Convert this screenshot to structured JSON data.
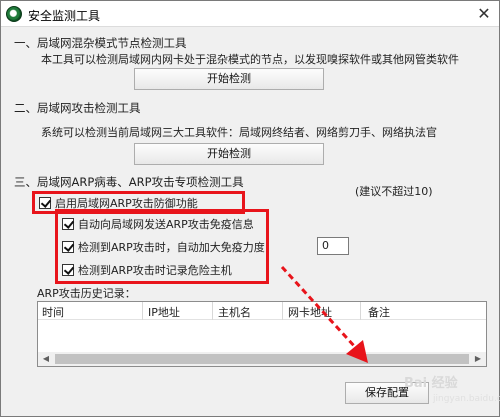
{
  "window": {
    "title": "安全监测工具",
    "close_glyph": "✕"
  },
  "section1": {
    "title": "一、局域网混杂模式节点检测工具",
    "description": "本工具可以检测局域网内网卡处于混杂模式的节点，以发现嗅探软件或其他网管类软件",
    "button_label": "开始检测"
  },
  "section2": {
    "title": "二、局域网攻击检测工具",
    "description": "系统可以检测当前局域网三大工具软件：局域网终结者、网络剪刀手、网络执法官",
    "button_label": "开始检测"
  },
  "section3": {
    "title": "三、局域网ARP病毒、ARP攻击专项检测工具",
    "note": "(建议不超过10)",
    "enable_label": "启用局域网ARP攻击防御功能",
    "options": [
      {
        "label": "自动向局域网发送ARP攻击免疫信息",
        "checked": true
      },
      {
        "label": "检测到ARP攻击时，自动加大免疫力度",
        "checked": true
      },
      {
        "label": "检测到ARP攻击时记录危险主机",
        "checked": true
      }
    ],
    "immunity_value": "0"
  },
  "history": {
    "label": "ARP攻击历史记录：",
    "columns": [
      "时间",
      "IP地址",
      "主机名",
      "网卡地址",
      "备注"
    ]
  },
  "save_button_label": "保存配置",
  "watermark": {
    "main": "Bai 经验",
    "sub": "jingyan.baidu.com"
  },
  "colors": {
    "highlight_red": "#e8141b"
  }
}
